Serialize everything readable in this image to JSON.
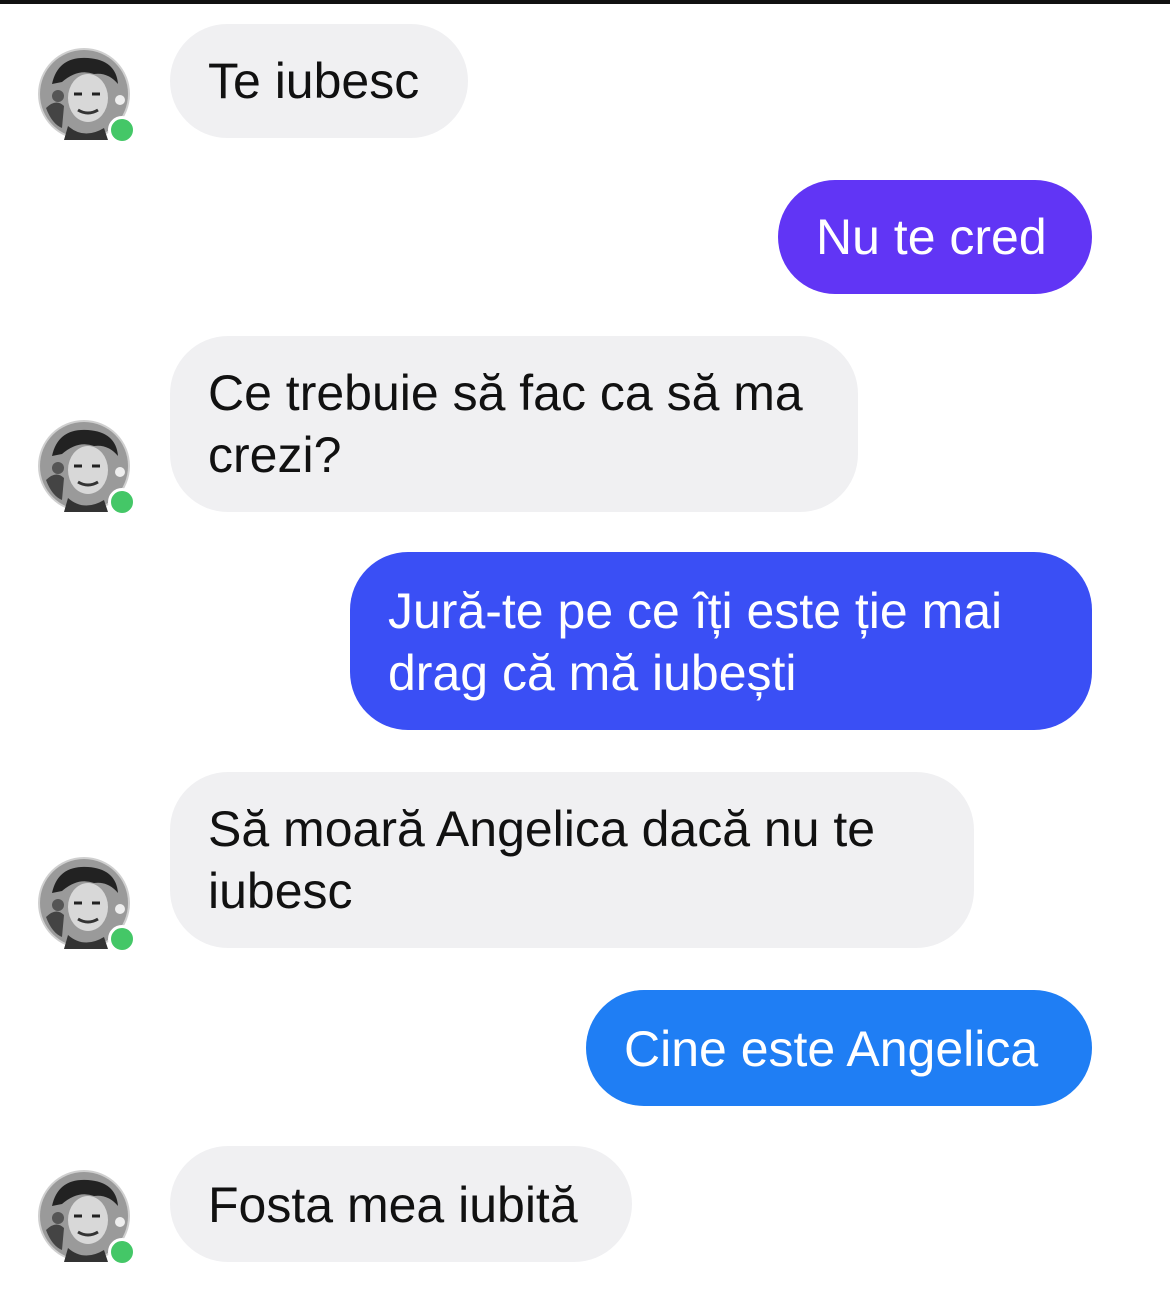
{
  "conversation": {
    "messages": [
      {
        "direction": "incoming",
        "text": "Te iubesc"
      },
      {
        "direction": "outgoing",
        "text": "Nu te cred",
        "color": "#6135f5"
      },
      {
        "direction": "incoming",
        "text": "Ce trebuie să fac ca să ma crezi?"
      },
      {
        "direction": "outgoing",
        "text": "Jură-te pe ce îți este ție mai drag că mă iubești",
        "color": "#3a4ff5"
      },
      {
        "direction": "incoming",
        "text": "Să moară Angelica dacă nu te iubesc"
      },
      {
        "direction": "outgoing",
        "text": "Cine este Angelica",
        "color": "#1f7ef4"
      },
      {
        "direction": "incoming",
        "text": "Fosta mea iubită"
      }
    ],
    "avatar_icon": "contact-avatar-photo",
    "online_status_color": "#44c767",
    "incoming_bubble_color": "#f0f0f2"
  }
}
